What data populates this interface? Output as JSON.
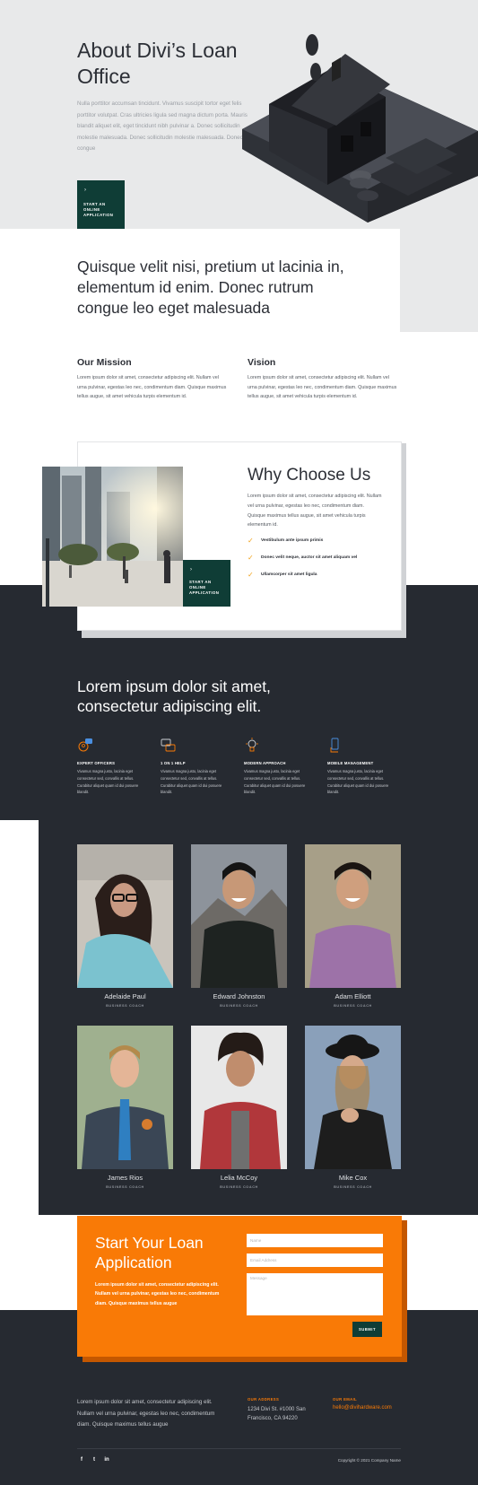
{
  "hero": {
    "title": "About Divi’s Loan Office",
    "text": "Nulla porttitor accumsan tincidunt. Vivamus suscipit tortor eget felis porttitor volutpat. Cras ultricies ligula sed magna dictum porta. Mauris blandit aliquet elit, eget tincidunt nibh pulvinar a. Donec sollicitudin molestie malesuada. Donec sollicitudin molestie malesuada. Donec rutrum congue",
    "cta_arrow": "›",
    "cta_label": "START AN ONLINE APPLICATION"
  },
  "quote": "Quisque velit nisi, pretium ut lacinia in, elementum id enim. Donec rutrum congue leo eget malesuada",
  "mission": {
    "title": "Our Mission",
    "text": "Lorem ipsum dolor sit amet, consectetur adipiscing elit. Nullam vel urna pulvinar, egestas leo nec, condimentum diam. Quisque maximus tellus augue, sit amet vehicula turpis elementum id."
  },
  "vision": {
    "title": "Vision",
    "text": "Lorem ipsum dolor sit amet, consectetur adipiscing elit. Nullam vel urna pulvinar, egestas leo nec, condimentum diam. Quisque maximus tellus augue, sit amet vehicula turpis elementum id."
  },
  "why": {
    "title": "Why Choose Us",
    "text": "Lorem ipsum dolor sit amet, consectetur adipiscing elit. Nullam vel urna pulvinar, egestas leo nec, condimentum diam. Quisque maximus tellus augue, sit amet vehicula turpis elementum id.",
    "checks": [
      "Vestibulum ante ipsum primis",
      "Donec velit neque, auctor sit amet aliquam vel",
      "Ullamcorper sit amet ligula"
    ],
    "cta_arrow": "›",
    "cta_label": "START AN ONLINE APPLICATION",
    "check_icon": "checkmark-icon"
  },
  "features": {
    "title": "Lorem ipsum dolor sit amet, consectetur adipiscing elit.",
    "items": [
      {
        "icon": "chat-person-icon",
        "label": "EXPERT OFFICERS",
        "text": "Vivamus magna justo, lacinia eget consectetur sed, convallis at tellus. Curabitur aliquet quam id dui posuere blandit."
      },
      {
        "icon": "chat-bubbles-icon",
        "label": "1 ON 1 HELP",
        "text": "Vivamus magna justo, lacinia eget consectetur sed, convallis at tellus. Curabitur aliquet quam id dui posuere blandit."
      },
      {
        "icon": "lightbulb-icon",
        "label": "MODERN APPROACH",
        "text": "Vivamus magna justo, lacinia eget consectetur sed, convallis at tellus. Curabitur aliquet quam id dui posuere blandit."
      },
      {
        "icon": "mobile-hand-icon",
        "label": "MOBILE MANAGEMENT",
        "text": "Vivamus magna justo, lacinia eget consectetur sed, convallis at tellus. Curabitur aliquet quam id dui posuere blandit."
      }
    ]
  },
  "team": [
    {
      "name": "Adelaide Paul",
      "role": "BUSINESS COACH"
    },
    {
      "name": "Edward Johnston",
      "role": "BUSINESS COACH"
    },
    {
      "name": "Adam Elliott",
      "role": "BUSINESS COACH"
    },
    {
      "name": "James Rios",
      "role": "BUSINESS COACH"
    },
    {
      "name": "Lelia McCoy",
      "role": "BUSINESS COACH"
    },
    {
      "name": "Mike Cox",
      "role": "BUSINESS COACH"
    }
  ],
  "loan": {
    "title": "Start Your Loan Application",
    "text": "Lorem ipsum dolor sit amet, consectetur adipiscing elit. Nullam vel urna pulvinar, egestas leo nec, condimentum diam. Quisque maximus tellus augue",
    "name_placeholder": "Name",
    "email_placeholder": "Email Address",
    "message_placeholder": "Message",
    "submit": "SUBMIT"
  },
  "footer": {
    "text": "Lorem ipsum dolor sit amet, consectetur adipiscing elit. Nullam vel urna pulvinar, egestas leo nec, condimentum diam. Quisque maximus tellus augue",
    "address_label": "OUR ADDRESS",
    "address_line1": "1234 Divi St. #1000 San",
    "address_line2": "Francisco, CA 94220",
    "email_label": "OUR EMAIL",
    "email": "hello@divihardware.com",
    "social": [
      {
        "icon": "facebook-icon",
        "glyph": "f"
      },
      {
        "icon": "twitter-icon",
        "glyph": "t"
      },
      {
        "icon": "linkedin-icon",
        "glyph": "in"
      }
    ],
    "copyright": "Copyright © 2021 Company Name"
  },
  "colors": {
    "accent_orange": "#f97a06",
    "dark": "#262a31",
    "green": "#0f3d36",
    "check": "#f0a21a"
  }
}
